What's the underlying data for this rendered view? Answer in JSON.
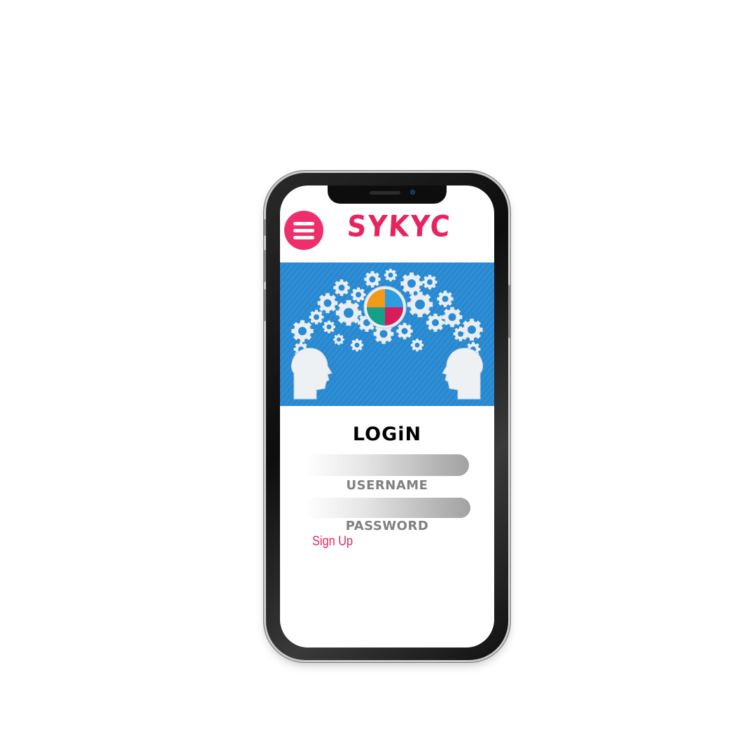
{
  "app": {
    "brand": "SYKYC",
    "brand_color": "#e6255f",
    "accent": "#ef2f6b"
  },
  "header": {
    "menu_icon": "hamburger-icon"
  },
  "hero": {
    "description_icons": [
      "gear-icon",
      "puzzle-icon",
      "head-silhouette-icon"
    ],
    "background": "#2a8bd4"
  },
  "login": {
    "title": "LOGiN",
    "username_label": "USERNAME",
    "password_label": "PASSWORD",
    "username_value": "",
    "password_value": "",
    "signup_label": "Sign Up"
  }
}
